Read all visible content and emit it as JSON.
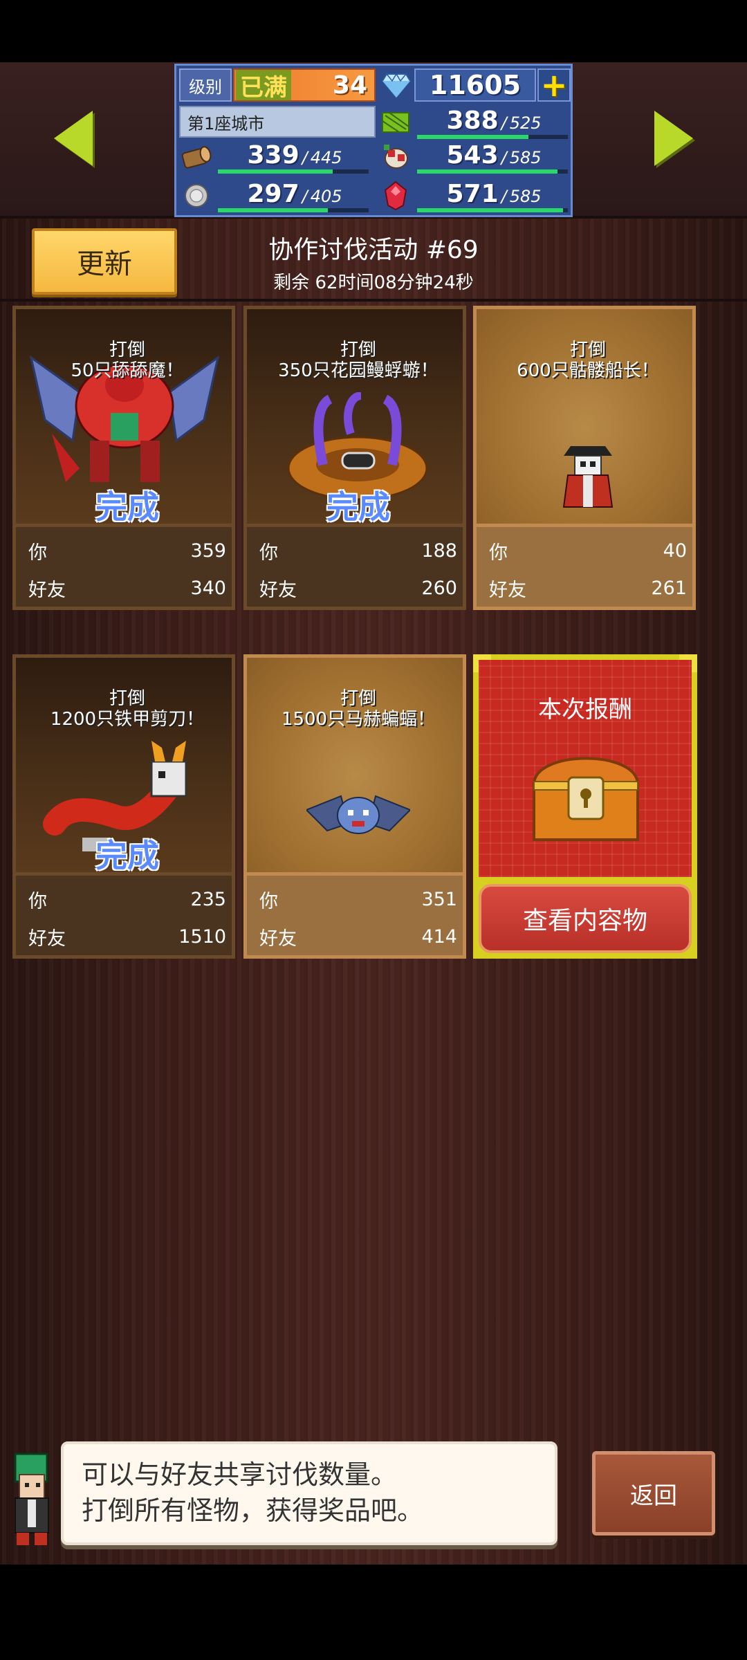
{
  "hud": {
    "level_label": "级别",
    "level_max": "已满",
    "level_value": "34",
    "gems": "11605",
    "plus": "+",
    "city": "第1座城市",
    "resources": [
      {
        "icon": "wood-log-icon",
        "current": "339",
        "max": "445",
        "fill": 0.76
      },
      {
        "icon": "herb-icon",
        "current": "388",
        "max": "525",
        "fill": 0.74
      },
      {
        "icon": "meat-icon",
        "current": "543",
        "max": "585",
        "fill": 0.93
      },
      {
        "icon": "stone-icon",
        "current": "297",
        "max": "405",
        "fill": 0.73
      },
      {
        "icon": "ruby-icon",
        "current": "571",
        "max": "585",
        "fill": 0.97
      }
    ],
    "separator": "/"
  },
  "event": {
    "update_label": "更新",
    "title": "协作讨伐活动 #69",
    "timer": "剩余 62时间08分钟24秒"
  },
  "labels": {
    "you": "你",
    "friend": "好友",
    "done": "完成"
  },
  "cards": [
    {
      "line1": "打倒",
      "line2": "50只舔舔魔！",
      "done": true,
      "you": "359",
      "friend": "340"
    },
    {
      "line1": "打倒",
      "line2": "350只花园鳗蜉蝣！",
      "done": true,
      "you": "188",
      "friend": "260"
    },
    {
      "line1": "打倒",
      "line2": "600只骷髅船长！",
      "done": false,
      "you": "40",
      "friend": "261"
    },
    {
      "line1": "打倒",
      "line2": "1200只铁甲剪刀！",
      "done": true,
      "you": "235",
      "friend": "1510"
    },
    {
      "line1": "打倒",
      "line2": "1500只马赫蝙蝠！",
      "done": false,
      "you": "351",
      "friend": "414"
    }
  ],
  "reward": {
    "title": "本次报酬",
    "view_label": "查看内容物"
  },
  "dialog": {
    "line1": "可以与好友共享讨伐数量。",
    "line2": "打倒所有怪物，获得奖品吧。"
  },
  "back_label": "返回",
  "colors": {
    "accent_green": "#b8d82a",
    "done_blue": "#5a8aff",
    "reward_red": "#c82a22",
    "update_gold": "#f5b840"
  }
}
